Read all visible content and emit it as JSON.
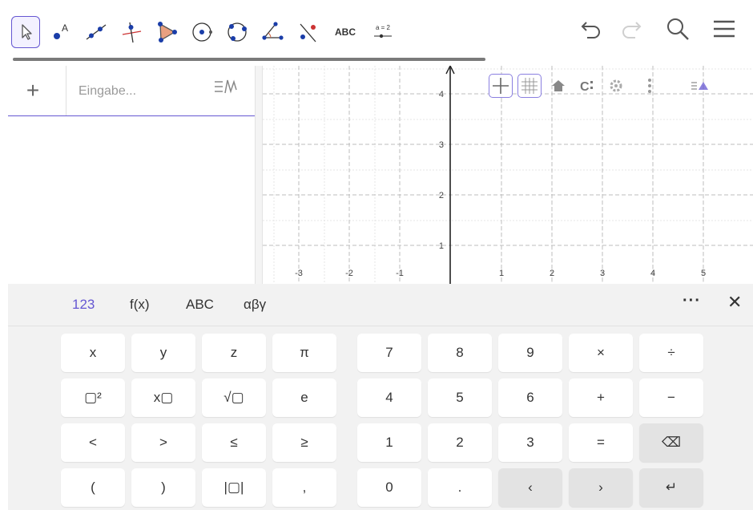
{
  "toolbar": {
    "tools": [
      {
        "name": "move-tool",
        "icon": "cursor-arrow-icon",
        "selected": true
      },
      {
        "name": "point-tool",
        "icon": "point-icon"
      },
      {
        "name": "line-tool",
        "icon": "line-icon"
      },
      {
        "name": "perpendicular-line-tool",
        "icon": "perpendicular-icon"
      },
      {
        "name": "polygon-tool",
        "icon": "polygon-icon"
      },
      {
        "name": "circle-center-point-tool",
        "icon": "circle-center-icon"
      },
      {
        "name": "circle-three-points-tool",
        "icon": "circle-three-points-icon"
      },
      {
        "name": "angle-tool",
        "icon": "angle-icon"
      },
      {
        "name": "reflect-line-tool",
        "icon": "reflect-icon"
      },
      {
        "name": "text-tool",
        "icon": "text-icon",
        "label": "ABC"
      },
      {
        "name": "slider-tool",
        "icon": "slider-icon",
        "label": "a = 2"
      }
    ],
    "undo_icon": "undo-icon",
    "redo_icon": "redo-icon",
    "search_icon": "search-icon",
    "menu_icon": "hamburger-icon"
  },
  "algebra": {
    "add_icon": "plus-icon",
    "input_placeholder": "Eingabe...",
    "menu_icon": "algebra-menu-icon"
  },
  "graphics": {
    "x_ticks": [
      "-3",
      "-2",
      "-1",
      "1",
      "2",
      "3",
      "4",
      "5"
    ],
    "y_ticks": [
      "1",
      "2",
      "3",
      "4"
    ],
    "style_bar": {
      "axes_icon": "axes-toggle-icon",
      "grid_icon": "grid-toggle-icon",
      "home_icon": "home-icon",
      "label_style_icon": "label-style-icon",
      "settings_icon": "gear-icon",
      "more_icon": "more-vertical-icon",
      "view_toggle_icon": "graphics-view-toggle-icon"
    }
  },
  "keyboard": {
    "tabs": [
      "123",
      "f(x)",
      "ABC",
      "αβγ"
    ],
    "active_tab": "123",
    "more_label": "···",
    "close_label": "✕",
    "rows": [
      [
        "x",
        "y",
        "z",
        "π",
        "7",
        "8",
        "9",
        "×",
        "÷"
      ],
      [
        "▢²",
        "x▢",
        "√▢",
        "e",
        "4",
        "5",
        "6",
        "+",
        "−"
      ],
      [
        "<",
        ">",
        "≤",
        "≥",
        "1",
        "2",
        "3",
        "=",
        "⌫"
      ],
      [
        "(",
        ")",
        "|▢|",
        ",",
        "0",
        ".",
        "‹",
        "›",
        "↵"
      ]
    ]
  },
  "colors": {
    "accent": "#6557d2",
    "polygon_fill": "#e8a080",
    "point_blue": "#1a3da8",
    "point_red": "#cc3333",
    "grid_major": "#c8c8c8",
    "key_gray": "#e3e3e3"
  }
}
